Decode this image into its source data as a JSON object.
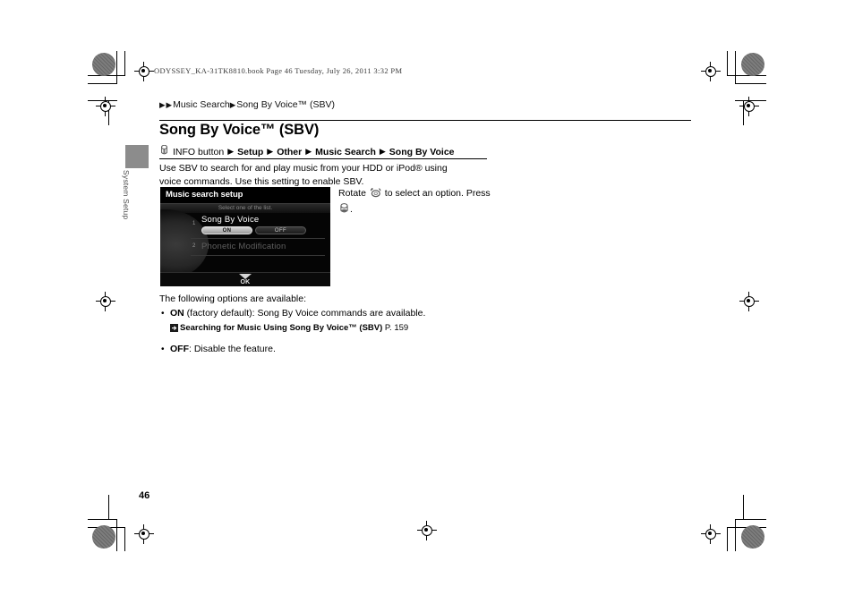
{
  "document": {
    "header_line": "ODYSSEY_KA-31TK8810.book  Page 46  Tuesday, July 26, 2011  3:32 PM",
    "page_number": "46"
  },
  "breadcrumb": {
    "arrow1": "▶",
    "arrow2": "▶",
    "item1": "Music Search",
    "arrow3": "▶",
    "item2": "Song By Voice™ (SBV)"
  },
  "page_title": "Song By Voice™ (SBV)",
  "nav_path": {
    "press_icon": "press-button-icon",
    "start": "INFO button",
    "triangle": "▶",
    "step1": "Setup",
    "step2": "Other",
    "step3": "Music Search",
    "step4": "Song By Voice"
  },
  "intro_text": "Use SBV to search for and play music from your HDD or iPod® using voice commands. Use this setting to enable SBV.",
  "side_tab": {
    "label": "System Setup"
  },
  "screen": {
    "title": "Music search setup",
    "subtitle": "Select one of the list.",
    "rows": [
      {
        "number": "1",
        "label": "Song By Voice",
        "toggle_on": "ON",
        "toggle_off": "OFF",
        "selected": "ON"
      },
      {
        "number": "2",
        "label": "Phonetic Modification"
      }
    ],
    "footer_label": "OK",
    "footer_icon": "down-triangle-icon"
  },
  "side_caption": {
    "part1": "Rotate",
    "rotate_icon": "rotary-dial-icon",
    "part2": "to select an option. Press",
    "press_icon": "press-button-icon",
    "part3": "."
  },
  "options": {
    "lead": "The following options are available:",
    "items": [
      {
        "bullet": "•",
        "name": "ON",
        "description": " (factory default): Song By Voice commands are available.",
        "xref_icon": "cross-reference-icon",
        "xref_title": "Searching for Music Using Song By Voice™ (SBV)",
        "xref_page": "P. 159"
      },
      {
        "bullet": "•",
        "name": "OFF",
        "description": ": Disable the feature."
      }
    ]
  },
  "colors": {
    "screen_background": "#000000",
    "tab_gray": "#8c8c8c",
    "registration_gray": "#7d7d7d"
  }
}
